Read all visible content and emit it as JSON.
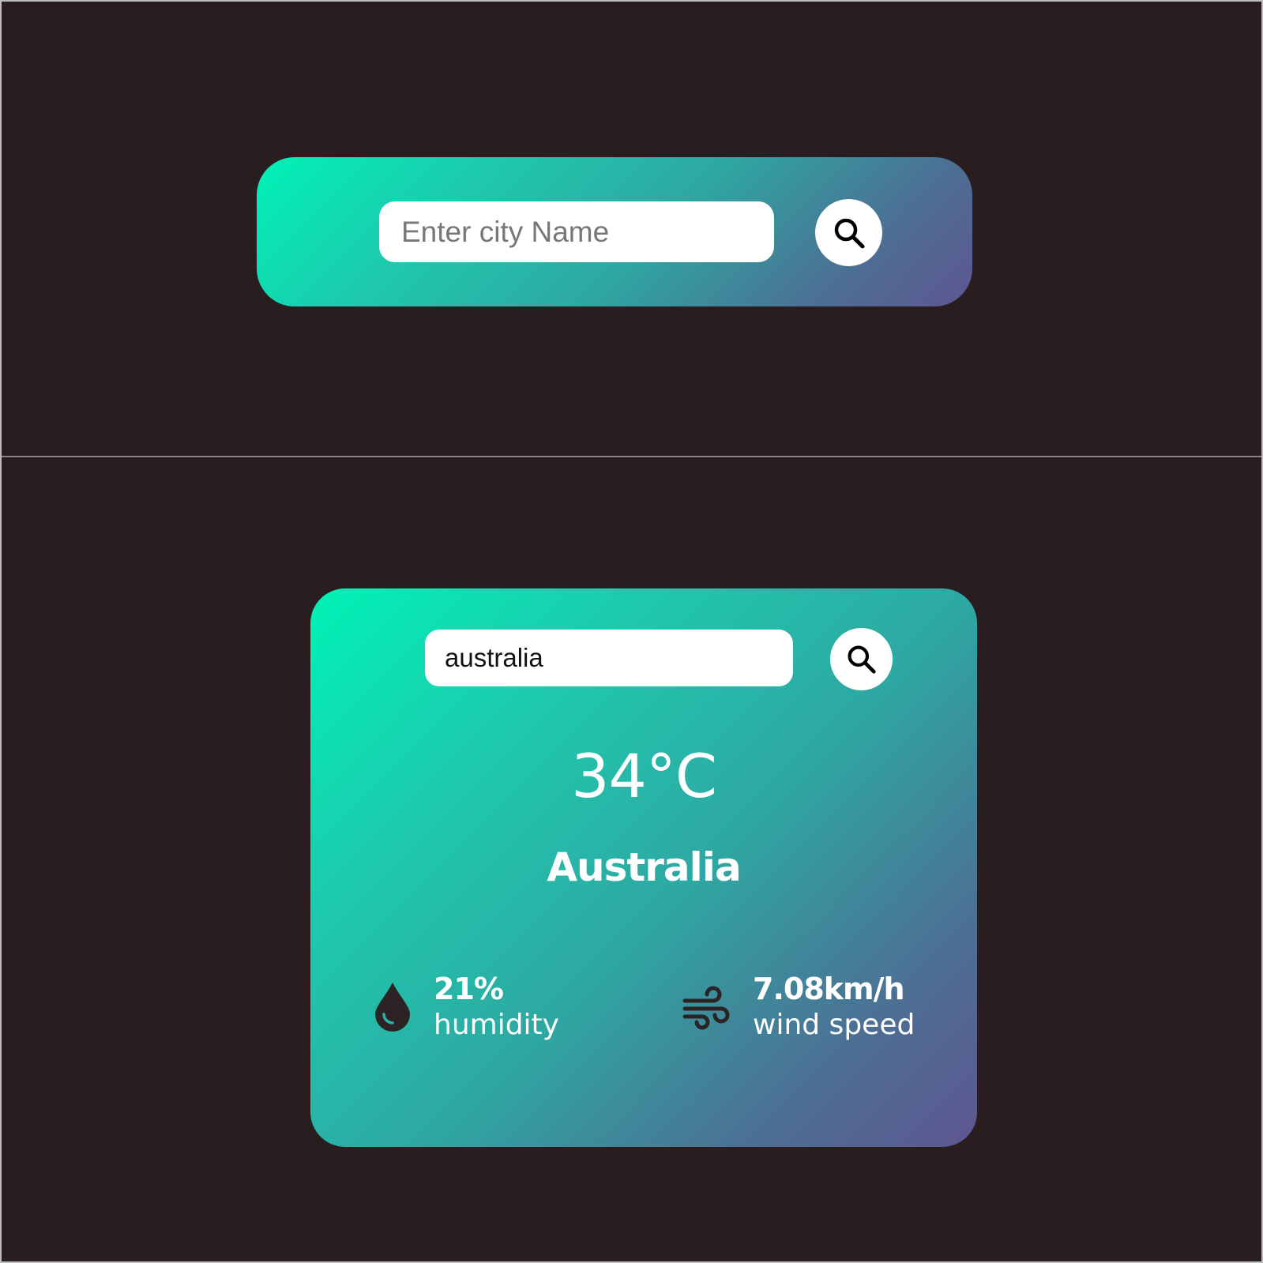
{
  "colors": {
    "background": "#291d1f",
    "gradient_start": "#00f2b6",
    "gradient_end": "#5e5690",
    "divider": "#8a8384"
  },
  "top_panel": {
    "search": {
      "placeholder": "Enter city Name",
      "value": "",
      "button_icon": "search-icon"
    }
  },
  "weather_card": {
    "search": {
      "value": "australia",
      "button_icon": "search-icon"
    },
    "temperature": "34°C",
    "city": "Australia",
    "humidity": {
      "icon": "water-drop-icon",
      "value": "21%",
      "label": "humidity"
    },
    "wind": {
      "icon": "wind-icon",
      "value": "7.08km/h",
      "label": "wind speed"
    }
  }
}
